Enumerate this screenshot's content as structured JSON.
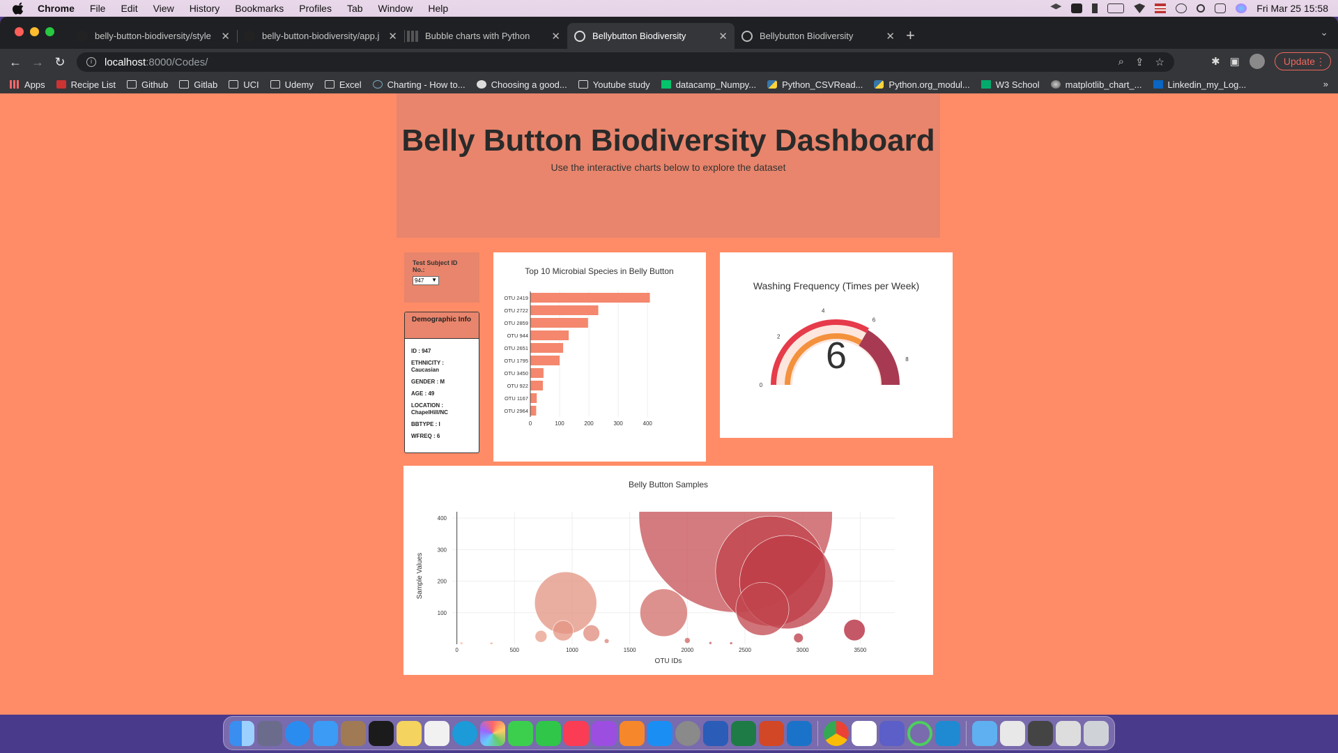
{
  "menubar": {
    "app": "Chrome",
    "items": [
      "File",
      "Edit",
      "View",
      "History",
      "Bookmarks",
      "Profiles",
      "Tab",
      "Window",
      "Help"
    ],
    "clock": "Fri Mar 25  15:58"
  },
  "tabs": [
    {
      "title": "belly-button-biodiversity/style",
      "active": false
    },
    {
      "title": "belly-button-biodiversity/app.j",
      "active": false
    },
    {
      "title": "Bubble charts with Python",
      "active": false
    },
    {
      "title": "Bellybutton Biodiversity",
      "active": true
    },
    {
      "title": "Bellybutton Biodiversity",
      "active": false
    }
  ],
  "address": {
    "host": "localhost",
    "path": ":8000/Codes/"
  },
  "update_label": "Update",
  "bookmarks": [
    {
      "label": "Apps",
      "icon": "apps-grid-icon"
    },
    {
      "label": "Recipe List",
      "icon": "recipe-icon"
    },
    {
      "label": "Github",
      "icon": "folder-icon"
    },
    {
      "label": "Gitlab",
      "icon": "folder-icon"
    },
    {
      "label": "UCI",
      "icon": "folder-icon"
    },
    {
      "label": "Udemy",
      "icon": "folder-icon"
    },
    {
      "label": "Excel",
      "icon": "folder-icon"
    },
    {
      "label": "Charting - How to...",
      "icon": "chart-site-icon"
    },
    {
      "label": "Choosing a good...",
      "icon": "globe-icon"
    },
    {
      "label": "Youtube study",
      "icon": "folder-icon"
    },
    {
      "label": "datacamp_Numpy...",
      "icon": "datacamp-icon"
    },
    {
      "label": "Python_CSVRead...",
      "icon": "python-icon"
    },
    {
      "label": "Python.org_modul...",
      "icon": "python-icon"
    },
    {
      "label": "W3 School",
      "icon": "w3-icon"
    },
    {
      "label": "matplotlib_chart_...",
      "icon": "matplotlib-icon"
    },
    {
      "label": "Linkedin_my_Log...",
      "icon": "linkedin-icon"
    }
  ],
  "page": {
    "title": "Belly Button Biodiversity Dashboard",
    "subtitle": "Use the interactive charts below to explore the dataset",
    "select_label": "Test Subject ID No.:",
    "selected_id": "947",
    "demo_header": "Demographic Info",
    "demographics": [
      "ID : 947",
      "ETHNICITY : Caucasian",
      "GENDER : M",
      "AGE : 49",
      "LOCATION : ChapelHill/NC",
      "BBTYPE : I",
      "WFREQ : 6"
    ]
  },
  "colors": {
    "page_bg": "#ff8c67",
    "panel": "#e8856c",
    "bar": "#f4876d"
  },
  "chart_data": [
    {
      "type": "bar",
      "title": "Top 10 Microbial Species in Belly Button",
      "orientation": "horizontal",
      "categories": [
        "OTU 2419",
        "OTU 2722",
        "OTU 2859",
        "OTU 944",
        "OTU 2651",
        "OTU 1795",
        "OTU 3450",
        "OTU 922",
        "OTU 1167",
        "OTU 2964"
      ],
      "values": [
        408,
        232,
        197,
        131,
        112,
        100,
        45,
        43,
        22,
        20
      ],
      "xticks": [
        0,
        100,
        200,
        300,
        400
      ],
      "xlim": [
        0,
        440
      ]
    },
    {
      "type": "gauge",
      "title": "Washing Frequency (Times per Week)",
      "value": 6,
      "value_label": "6",
      "range": [
        0,
        9
      ],
      "tick_labels": [
        "0",
        "2",
        "4",
        "6",
        "8"
      ]
    },
    {
      "type": "scatter",
      "title": "Belly Button Samples",
      "xlabel": "OTU IDs",
      "ylabel": "Sample Values",
      "xticks": [
        0,
        500,
        1000,
        1500,
        2000,
        2500,
        3000,
        3500
      ],
      "yticks": [
        100,
        200,
        300,
        400
      ],
      "xlim": [
        -40,
        3800
      ],
      "ylim": [
        0,
        420
      ],
      "points": [
        {
          "x": 40,
          "y": 3
        },
        {
          "x": 300,
          "y": 2
        },
        {
          "x": 730,
          "y": 25
        },
        {
          "x": 922,
          "y": 43
        },
        {
          "x": 944,
          "y": 131
        },
        {
          "x": 1167,
          "y": 35
        },
        {
          "x": 1300,
          "y": 10
        },
        {
          "x": 1795,
          "y": 100
        },
        {
          "x": 2000,
          "y": 12
        },
        {
          "x": 2200,
          "y": 4
        },
        {
          "x": 2380,
          "y": 3
        },
        {
          "x": 2419,
          "y": 408
        },
        {
          "x": 2651,
          "y": 112
        },
        {
          "x": 2722,
          "y": 232
        },
        {
          "x": 2859,
          "y": 197
        },
        {
          "x": 2964,
          "y": 20
        },
        {
          "x": 3450,
          "y": 45
        }
      ]
    }
  ]
}
